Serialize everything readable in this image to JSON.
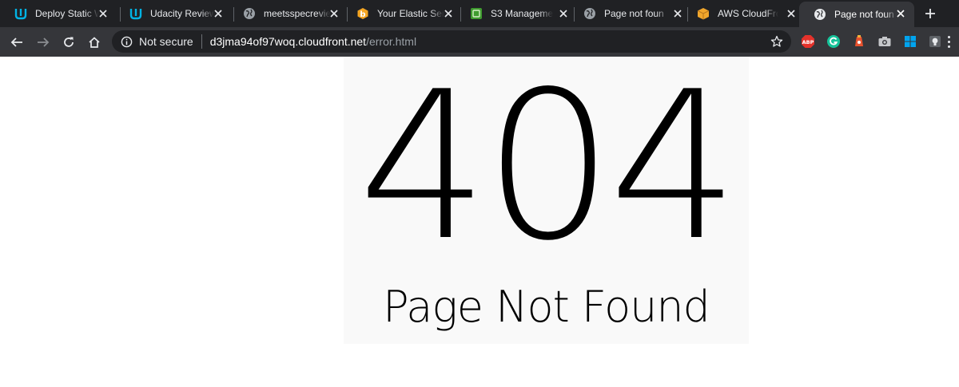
{
  "browser": {
    "tabs": [
      {
        "title": "Deploy Static W",
        "favicon": "udacity-icon",
        "active": false
      },
      {
        "title": "Udacity Review",
        "favicon": "udacity-icon",
        "active": false
      },
      {
        "title": "meetsspecrevie",
        "favicon": "globe-icon",
        "active": false
      },
      {
        "title": "Your Elastic Ser",
        "favicon": "bonsai-icon",
        "active": false
      },
      {
        "title": "S3 Manageme",
        "favicon": "s3-icon",
        "active": false
      },
      {
        "title": "Page not foun",
        "favicon": "globe-icon",
        "active": false
      },
      {
        "title": "AWS CloudFro",
        "favicon": "aws-box-icon",
        "active": false
      },
      {
        "title": "Page not foun",
        "favicon": "globe-icon",
        "active": true
      }
    ],
    "address_bar": {
      "security_label": "Not secure",
      "url_host": "d3jma94of97woq.cloudfront.net",
      "url_path": "/error.html"
    },
    "extensions": [
      "adblock-plus-icon",
      "grammarly-icon",
      "extension-icon",
      "camera-icon",
      "windows-icon",
      "lightbulb-icon"
    ],
    "colors": {
      "tab_strip": "#202124",
      "toolbar": "#35363a",
      "omnibox": "#202124"
    }
  },
  "page": {
    "code": "404",
    "message": "Page Not Found",
    "panel_color": "#f9f9f9"
  }
}
